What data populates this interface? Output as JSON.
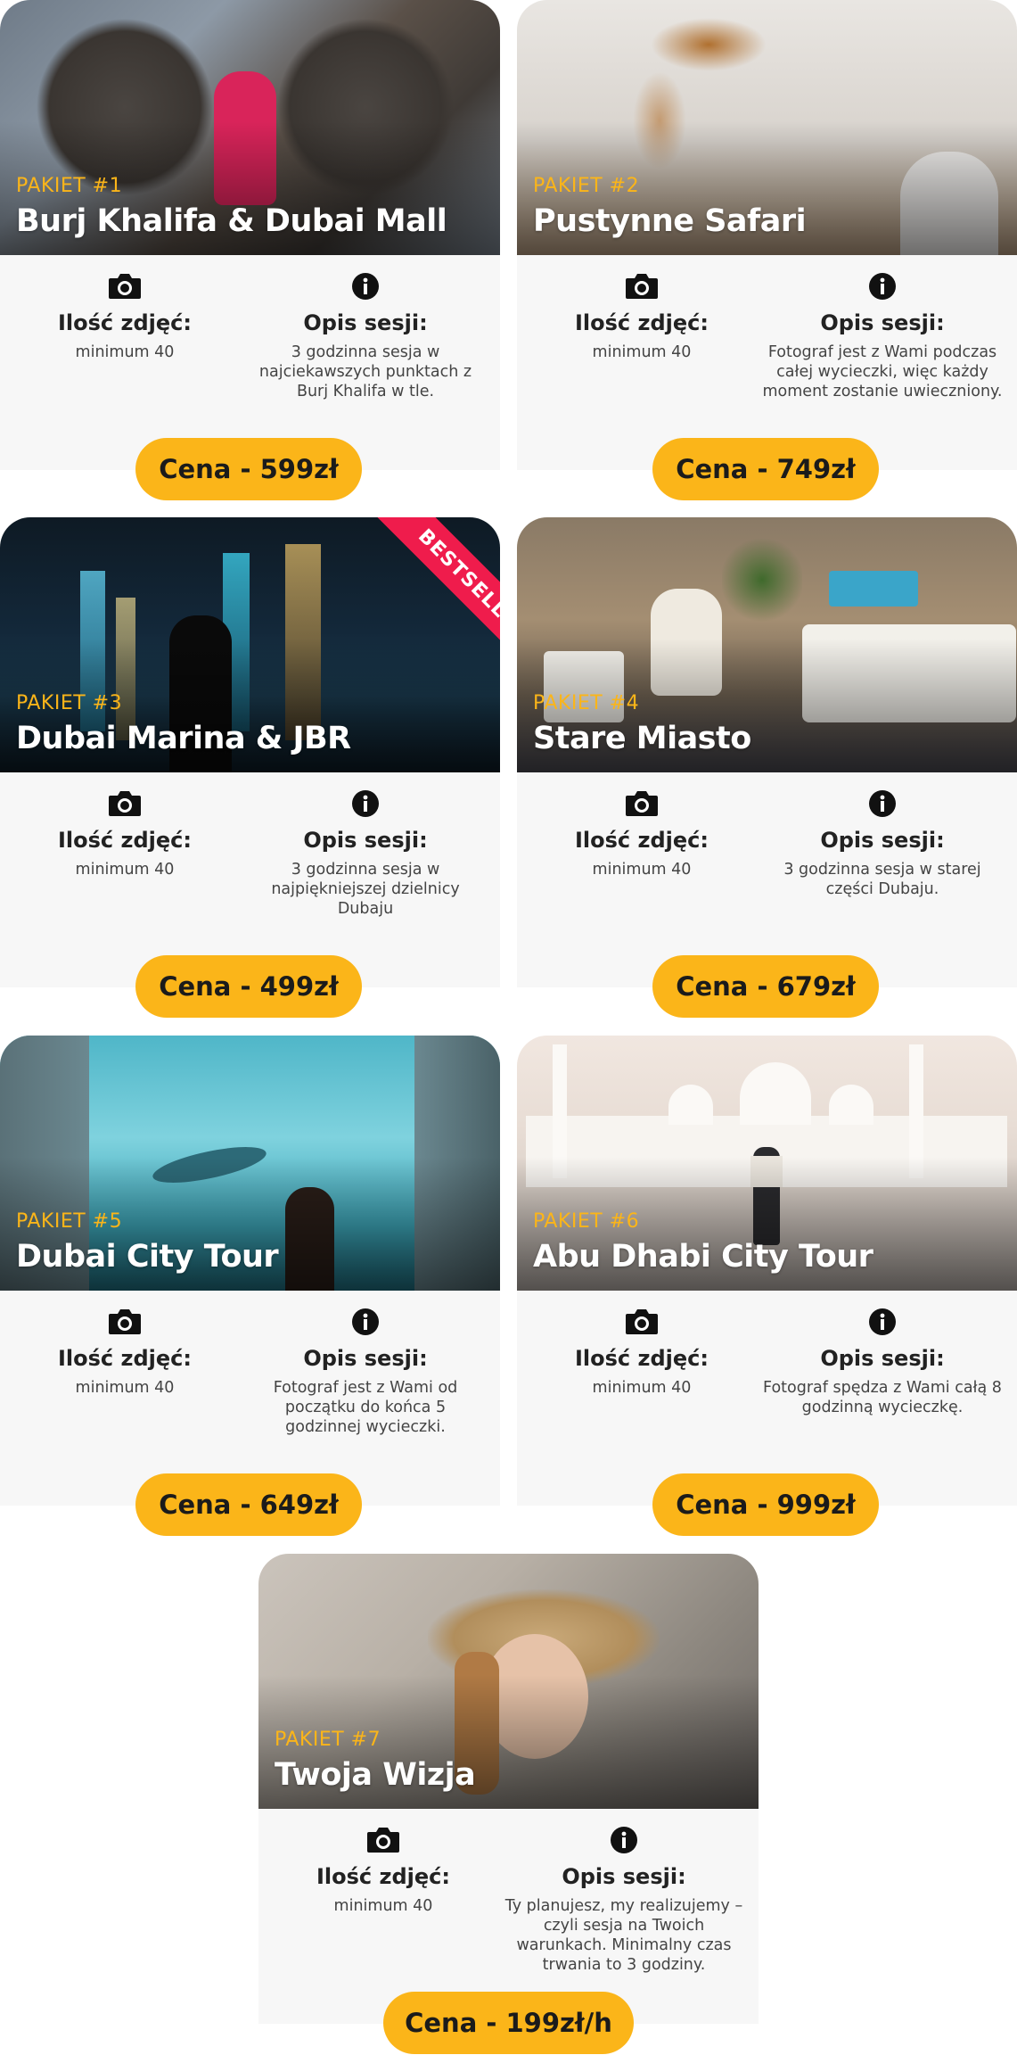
{
  "common": {
    "photos_label": "Ilość zdjęć:",
    "photos_value": "minimum 40",
    "desc_label": "Opis sesji:"
  },
  "badge": "BESTSELLER",
  "packages": [
    {
      "number": "PAKIET #1",
      "title": "Burj Khalifa & Dubai Mall",
      "description": "3 godzinna sesja w najciekawszych punktach z Burj Khalifa w tle.",
      "price": "Cena - 599zł"
    },
    {
      "number": "PAKIET #2",
      "title": "Pustynne Safari",
      "description": "Fotograf jest z Wami podczas całej wycieczki, więc każdy moment zostanie uwieczniony.",
      "price": "Cena - 749zł"
    },
    {
      "number": "PAKIET #3",
      "title": "Dubai Marina & JBR",
      "description": "3 godzinna sesja w najpiękniejszej dzielnicy Dubaju",
      "price": "Cena - 499zł"
    },
    {
      "number": "PAKIET #4",
      "title": "Stare Miasto",
      "description": "3 godzinna sesja w starej części Dubaju.",
      "price": "Cena - 679zł"
    },
    {
      "number": "PAKIET #5",
      "title": "Dubai City Tour",
      "description": "Fotograf jest z Wami od początku do końca 5 godzinnej wycieczki.",
      "price": "Cena - 649zł"
    },
    {
      "number": "PAKIET #6",
      "title": "Abu Dhabi City Tour",
      "description": "Fotograf spędza z Wami całą 8 godzinną wycieczkę.",
      "price": "Cena - 999zł"
    },
    {
      "number": "PAKIET #7",
      "title": "Twoja Wizja",
      "description": "Ty planujesz, my realizujemy – czyli sesja na Twoich warunkach. Minimalny czas trwania to 3 godziny.",
      "price": "Cena - 199zł/h"
    }
  ],
  "colors": {
    "accent": "#fbb519",
    "badge": "#ef1c4c",
    "panel": "#f7f7f7"
  }
}
